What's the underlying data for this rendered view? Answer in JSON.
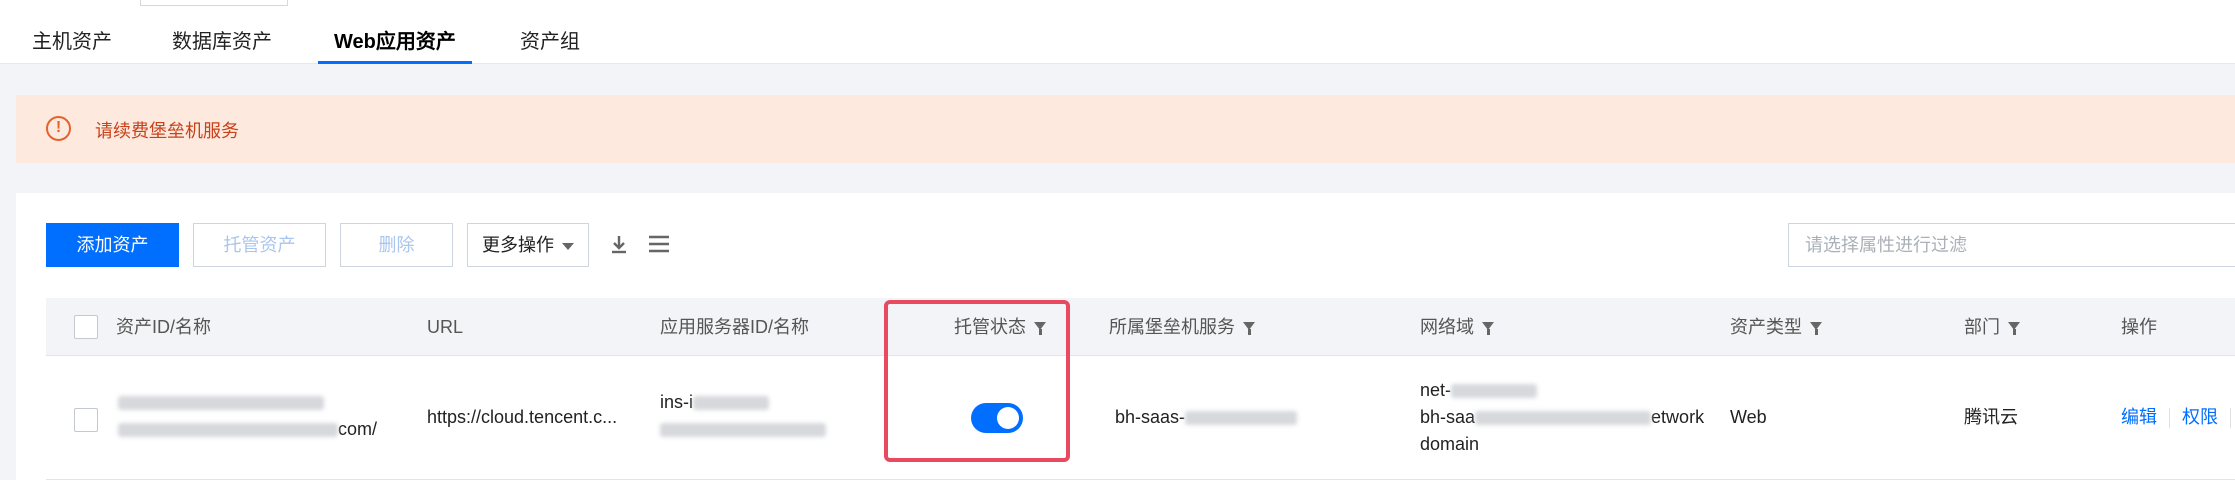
{
  "tabs": [
    {
      "label": "主机资产",
      "active": false
    },
    {
      "label": "数据库资产",
      "active": false
    },
    {
      "label": "Web应用资产",
      "active": true
    },
    {
      "label": "资产组",
      "active": false
    }
  ],
  "notice": {
    "icon": "warning-circle-icon",
    "text": "请续费堡垒机服务"
  },
  "toolbar": {
    "add_label": "添加资产",
    "host_label": "托管资产",
    "delete_label": "删除",
    "more_label": "更多操作",
    "download_icon": "download-icon",
    "settings_icon": "column-settings-icon",
    "filter_placeholder": "请选择属性进行过滤"
  },
  "table": {
    "columns": [
      "资产ID/名称",
      "URL",
      "应用服务器ID/名称",
      "托管状态",
      "所属堡垒机服务",
      "网络域",
      "资产类型",
      "部门",
      "操作"
    ],
    "rows": [
      {
        "id_name_suffix": "com/",
        "url": "https://cloud.tencent.c...",
        "server_prefix": "ins-i",
        "hosted": true,
        "bastion": "bh-saas-",
        "netdomain_line1": "net-",
        "netdomain_line2_prefix": "bh-saa",
        "netdomain_line2_suffix": "etwork",
        "netdomain_line3": "domain",
        "type": "Web",
        "department": "腾讯云",
        "actions": [
          "编辑",
          "权限"
        ]
      }
    ]
  },
  "colors": {
    "accent": "#006eff",
    "notice_bg": "#fde9dd",
    "notice_text": "#c7411a",
    "highlight": "#e84a5f"
  }
}
